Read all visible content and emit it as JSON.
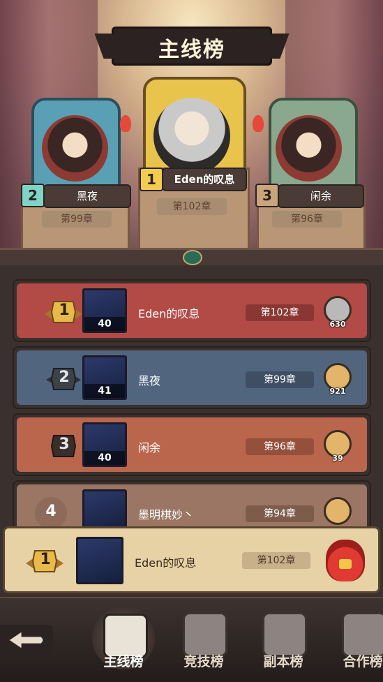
{
  "title": "主线榜",
  "podium": [
    {
      "rank": "2",
      "name": "黑夜",
      "chapter": "第99章",
      "badge_color": "#7fd4c5"
    },
    {
      "rank": "1",
      "name": "Eden的叹息",
      "chapter": "第102章",
      "badge_color": "#f3cc4f"
    },
    {
      "rank": "3",
      "name": "闲余",
      "chapter": "第96章",
      "badge_color": "#c9a57d"
    }
  ],
  "ranking": [
    {
      "rank": "1",
      "level": "40",
      "name": "Eden的叹息",
      "chapter": "第102章",
      "likes": "630",
      "bg": "#b24a45",
      "like_color": "#b9b9b9"
    },
    {
      "rank": "2",
      "level": "41",
      "name": "黑夜",
      "chapter": "第99章",
      "likes": "921",
      "bg": "#51657f",
      "like_color": "#e2b56b"
    },
    {
      "rank": "3",
      "level": "40",
      "name": "闲余",
      "chapter": "第96章",
      "likes": "39",
      "bg": "#b9664c",
      "like_color": "#e2b56b"
    },
    {
      "rank": "4",
      "level": "",
      "name": "墨明棋妙丶",
      "chapter": "第94章",
      "likes": "",
      "bg": "#9b7664",
      "like_color": "#e2b56b"
    }
  ],
  "my_rank": {
    "rank": "1",
    "name": "Eden的叹息",
    "chapter": "第102章"
  },
  "nav": {
    "back_icon": "back-arrow-icon",
    "tabs": [
      {
        "label": "主线榜",
        "icon": "crown-throne-icon",
        "active": true
      },
      {
        "label": "竞技榜",
        "icon": "crossed-swords-icon",
        "active": false
      },
      {
        "label": "副本榜",
        "icon": "dungeon-gate-icon",
        "active": false
      },
      {
        "label": "合作榜",
        "icon": "handshake-icon",
        "active": false
      }
    ]
  },
  "colors": {
    "gold": "#f3cc4f",
    "panel": "#3a302d",
    "my_row": "#e6d2a4"
  }
}
